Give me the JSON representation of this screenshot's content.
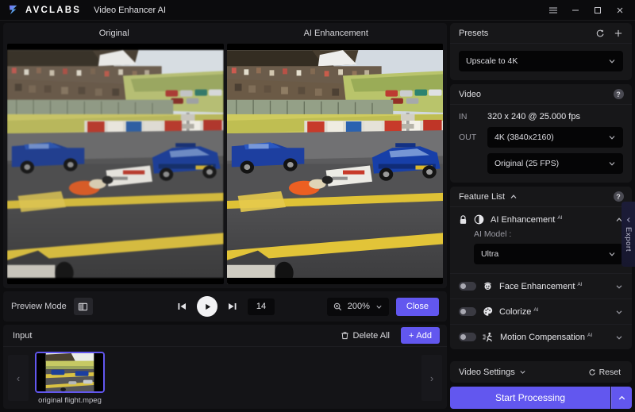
{
  "titlebar": {
    "brand": "AVCLABS",
    "app_title": "Video Enhancer AI",
    "menu_icon": "hamburger-icon",
    "minimize_icon": "minimize-icon",
    "maximize_icon": "maximize-icon",
    "close_icon": "close-icon"
  },
  "preview": {
    "left_label": "Original",
    "right_label": "AI Enhancement"
  },
  "controls": {
    "preview_mode_label": "Preview Mode",
    "split_view_icon": "split-view-icon",
    "prev_frame_icon": "skip-previous-icon",
    "play_icon": "play-icon",
    "next_frame_icon": "skip-next-icon",
    "frame_number": "14",
    "zoom_icon": "zoom-in-icon",
    "zoom_value": "200%",
    "close_label": "Close"
  },
  "input_panel": {
    "title": "Input",
    "delete_all_label": "Delete All",
    "delete_icon": "trash-icon",
    "add_label": "Add",
    "add_icon": "plus-icon",
    "prev_icon": "chevron-left-icon",
    "next_icon": "chevron-right-icon",
    "items": [
      {
        "filename": "original flight.mpeg"
      }
    ]
  },
  "presets": {
    "title": "Presets",
    "refresh_icon": "refresh-icon",
    "add_icon": "plus-icon",
    "selected": "Upscale to 4K"
  },
  "video": {
    "title": "Video",
    "help_icon": "help-icon",
    "in_label": "IN",
    "in_value": "320 x 240 @ 25.000 fps",
    "in_resolution": "320 x 240",
    "in_fps": "25.000 fps",
    "out_label": "OUT",
    "out_resolution": "4K (3840x2160)",
    "out_framerate": "Original (25 FPS)"
  },
  "feature_list": {
    "title": "Feature List",
    "collapse_icon": "chevron-up-icon",
    "help_icon": "help-icon",
    "ai_enhancement": {
      "name": "AI Enhancement",
      "badge": "AI",
      "lock_icon": "lock-icon",
      "feature_icon": "contrast-icon",
      "chevron_icon": "chevron-up-icon",
      "model_label": "AI Model :",
      "model_value": "Ultra"
    },
    "features": [
      {
        "name": "Face Enhancement",
        "badge": "AI",
        "icon": "face-icon",
        "enabled": false,
        "chevron_icon": "chevron-down-icon"
      },
      {
        "name": "Colorize",
        "badge": "AI",
        "icon": "palette-icon",
        "enabled": false,
        "chevron_icon": "chevron-down-icon"
      },
      {
        "name": "Motion Compensation",
        "badge": "AI",
        "icon": "motion-icon",
        "enabled": false,
        "chevron_icon": "chevron-down-icon"
      }
    ]
  },
  "video_settings": {
    "title": "Video Settings",
    "chevron_icon": "chevron-down-icon",
    "reset_label": "Reset",
    "reset_icon": "refresh-icon"
  },
  "start": {
    "label": "Start Processing",
    "chevron_icon": "chevron-up-icon"
  },
  "export_tab": {
    "label": "Export",
    "chevron_icon": "chevron-left-icon"
  },
  "colors": {
    "accent": "#6257ef",
    "panel": "#171719",
    "background": "#0d0d0f",
    "field": "#050506"
  }
}
